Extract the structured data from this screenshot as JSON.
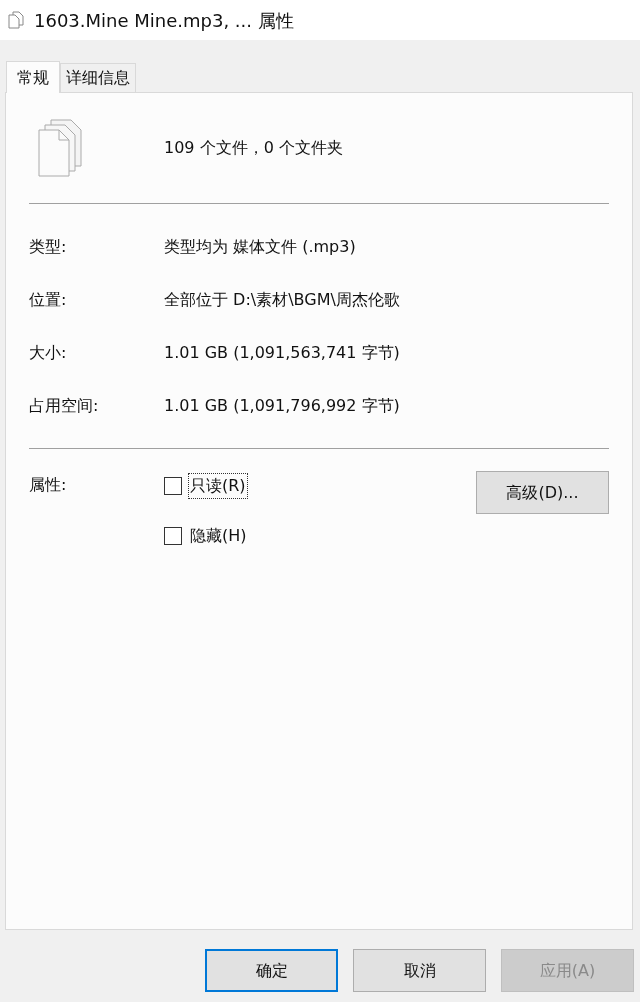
{
  "window": {
    "title": "1603.Mine Mine.mp3, ... 属性"
  },
  "tabs": [
    {
      "label": "常规",
      "selected": true
    },
    {
      "label": "详细信息",
      "selected": false
    }
  ],
  "summary": "109 个文件，0 个文件夹",
  "properties": [
    {
      "label": "类型:",
      "value": "类型均为 媒体文件 (.mp3)"
    },
    {
      "label": "位置:",
      "value": "全部位于 D:\\素材\\BGM\\周杰伦歌"
    },
    {
      "label": "大小:",
      "value": "1.01 GB (1,091,563,741 字节)"
    },
    {
      "label": "占用空间:",
      "value": "1.01 GB (1,091,796,992 字节)"
    }
  ],
  "attributes": {
    "label": "属性:",
    "options": [
      {
        "label": "只读(R)",
        "checked": false,
        "focused": true
      },
      {
        "label": "隐藏(H)",
        "checked": false,
        "focused": false
      }
    ],
    "advanced_button": "高级(D)..."
  },
  "buttons": [
    {
      "label": "确定",
      "default": true,
      "disabled": false
    },
    {
      "label": "取消",
      "default": false,
      "disabled": false
    },
    {
      "label": "应用(A)",
      "default": false,
      "disabled": true
    }
  ]
}
